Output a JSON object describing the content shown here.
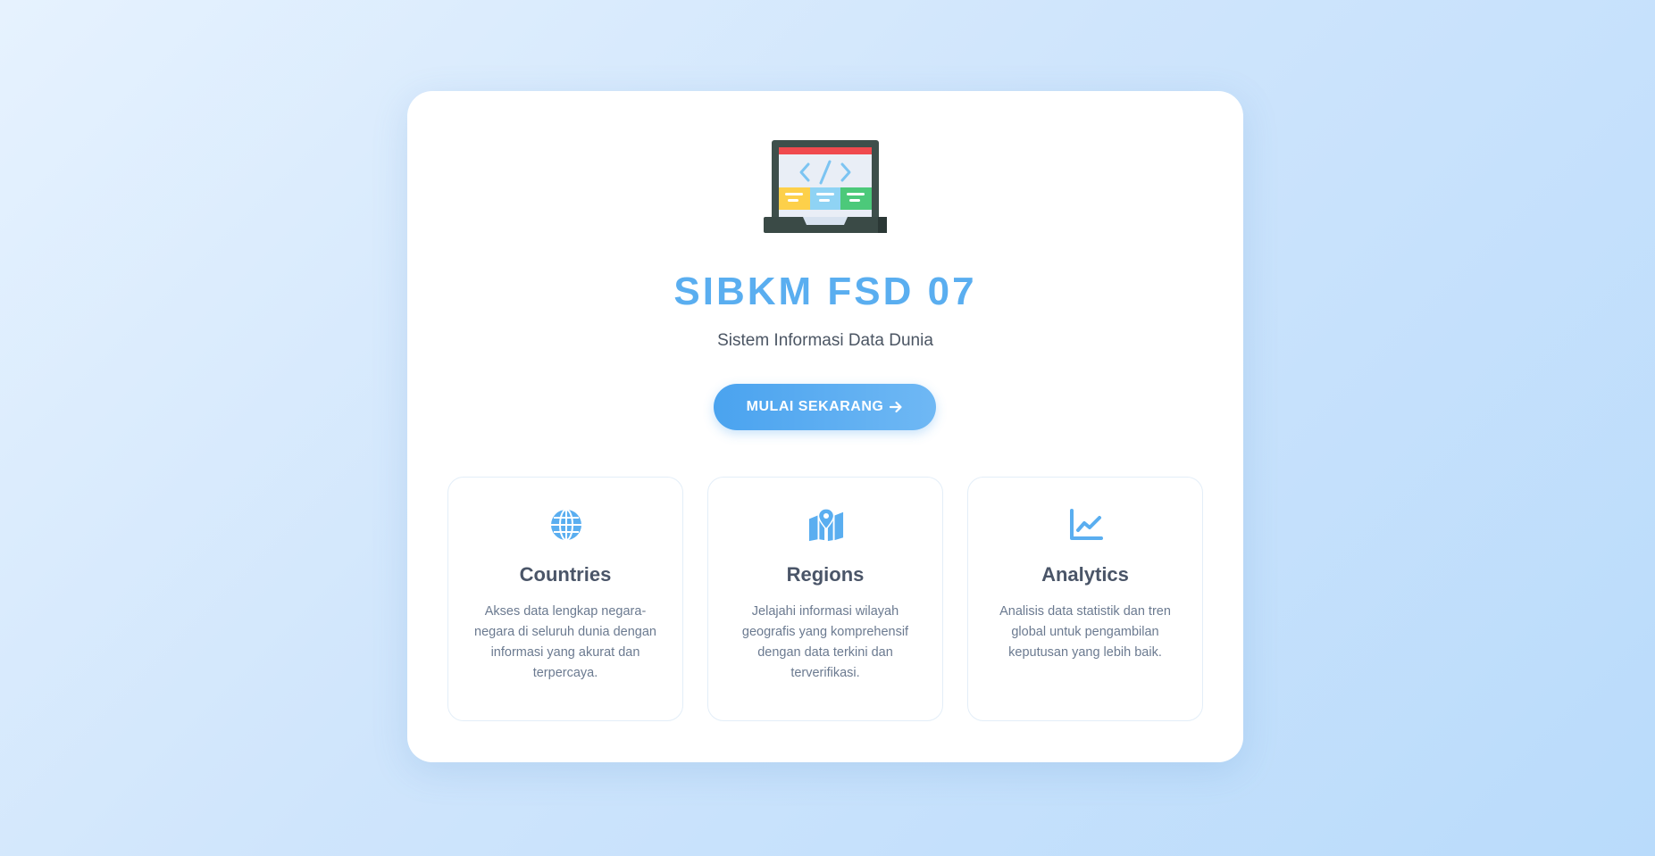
{
  "app": {
    "title": "SIBKM FSD 07",
    "subtitle": "Sistem Informasi Data Dunia"
  },
  "cta": {
    "label": "MULAI SEKARANG",
    "icon": "arrow-right-icon"
  },
  "hero": {
    "icon": "laptop-code-illustration"
  },
  "features": [
    {
      "icon": "globe-icon",
      "title": "Countries",
      "description": "Akses data lengkap negara-negara di seluruh dunia dengan informasi yang akurat dan terpercaya."
    },
    {
      "icon": "map-pin-icon",
      "title": "Regions",
      "description": "Jelajahi informasi wilayah geografis yang komprehensif dengan data terkini dan terverifikasi."
    },
    {
      "icon": "chart-line-icon",
      "title": "Analytics",
      "description": "Analisis data statistik dan tren global untuk pengambilan keputusan yang lebih baik."
    }
  ],
  "colors": {
    "accent": "#5aaef0",
    "text_dark": "#4a5568",
    "text_muted": "#6b7a90"
  }
}
